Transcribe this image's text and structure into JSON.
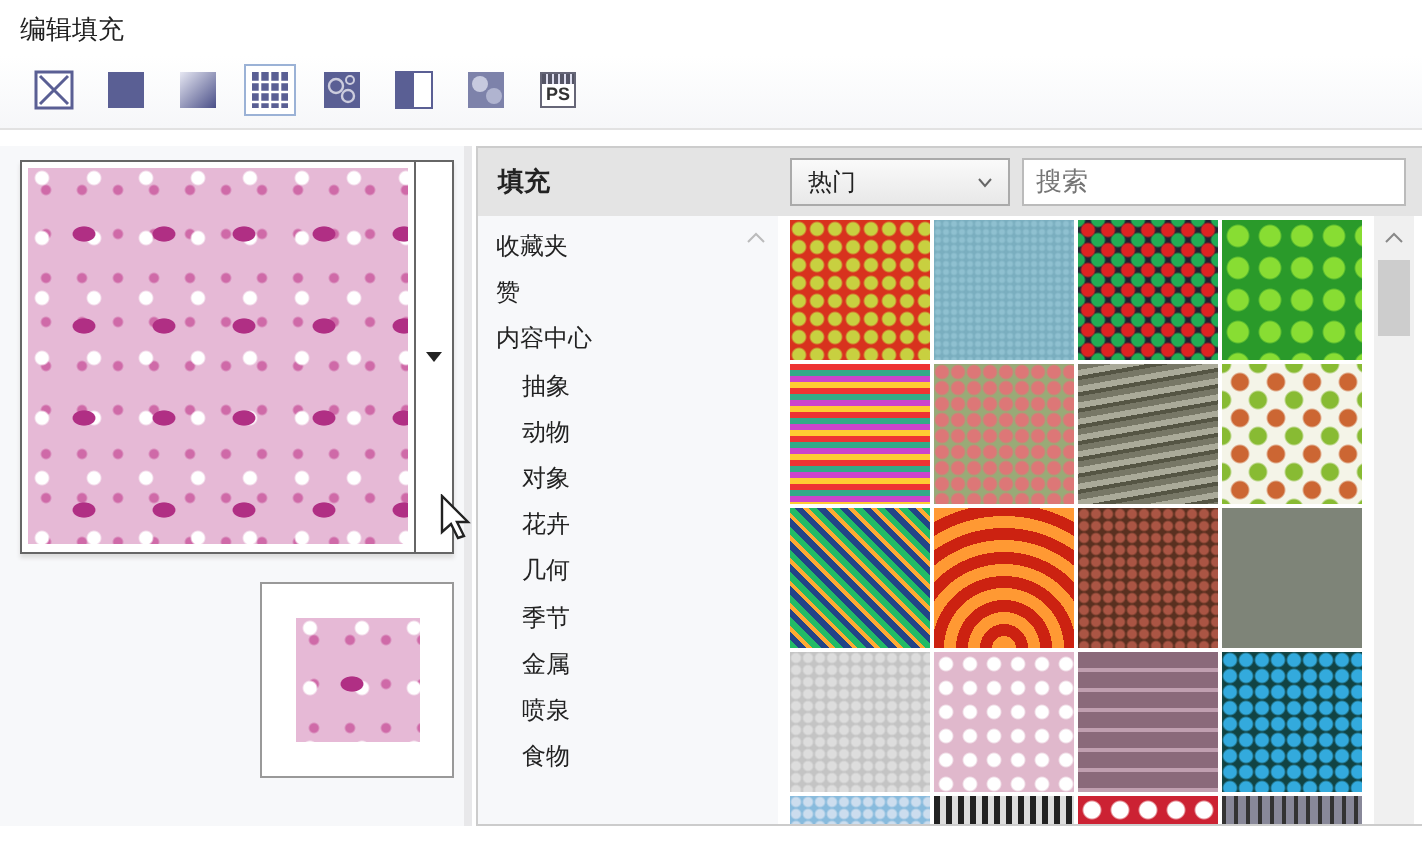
{
  "window": {
    "title": "编辑填充"
  },
  "fill_types": [
    {
      "kind": "none",
      "selected": false
    },
    {
      "kind": "uniform",
      "selected": false
    },
    {
      "kind": "fountain",
      "selected": false
    },
    {
      "kind": "vector",
      "selected": true
    },
    {
      "kind": "bitmap",
      "selected": false
    },
    {
      "kind": "twocolor",
      "selected": false
    },
    {
      "kind": "texture",
      "selected": false
    },
    {
      "kind": "postscript",
      "selected": false,
      "label": "PS"
    }
  ],
  "library": {
    "title": "填充",
    "source_dropdown": {
      "value": "热门"
    },
    "search": {
      "placeholder": "搜索"
    },
    "categories": [
      {
        "label": "收藏夹"
      },
      {
        "label": "赞"
      },
      {
        "label": "内容中心",
        "children": [
          {
            "label": "抽象"
          },
          {
            "label": "动物"
          },
          {
            "label": "对象"
          },
          {
            "label": "花卉"
          },
          {
            "label": "几何"
          },
          {
            "label": "季节"
          },
          {
            "label": "金属"
          },
          {
            "label": "喷泉"
          },
          {
            "label": "食物"
          }
        ]
      }
    ]
  }
}
